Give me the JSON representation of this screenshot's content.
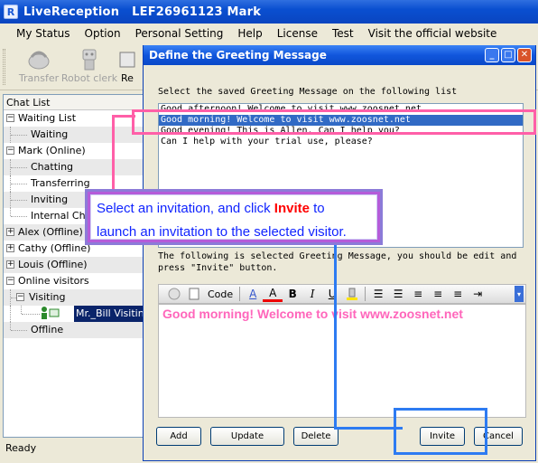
{
  "window": {
    "app_name": "LiveReception",
    "user": "LEF26961123 Mark"
  },
  "menu": [
    "My Status",
    "Option",
    "Personal Setting",
    "Help",
    "License",
    "Test",
    "Visit the official website"
  ],
  "toolbar": {
    "buttons": [
      {
        "label": "Transfer",
        "icon": "transfer-icon"
      },
      {
        "label": "Robot clerk",
        "icon": "robot-icon"
      },
      {
        "label": "Re",
        "icon": "refresh-icon"
      }
    ]
  },
  "chat_list": {
    "header": "Chat List",
    "items": [
      {
        "label": "Waiting List",
        "level": 0,
        "expander": "−"
      },
      {
        "label": "Waiting",
        "level": 1
      },
      {
        "label": "Mark (Online)",
        "level": 0,
        "expander": "−"
      },
      {
        "label": "Chatting",
        "level": 1
      },
      {
        "label": "Transferring",
        "level": 1
      },
      {
        "label": "Inviting",
        "level": 1
      },
      {
        "label": "Internal Chat",
        "level": 1
      },
      {
        "label": "Alex (Offline)",
        "level": 0,
        "expander": "+"
      },
      {
        "label": "Cathy (Offline)",
        "level": 0,
        "expander": "+"
      },
      {
        "label": "Louis (Offline)",
        "level": 0,
        "expander": "+"
      },
      {
        "label": "Online visitors",
        "level": 0,
        "expander": "−"
      },
      {
        "label": "Visiting",
        "level": 1,
        "expander": "−"
      },
      {
        "label": "Mr._Bill Visiting",
        "level": 2,
        "selected": true
      },
      {
        "label": "Offline",
        "level": 1
      }
    ]
  },
  "status_bar": "Ready",
  "dialog": {
    "title": "Define the Greeting Message",
    "list_label": "Select the saved Greeting Message on the following list",
    "greetings": [
      "Good afternoon! Welcome to visit www.zoosnet.net",
      "Good morning! Welcome to visit www.zoosnet.net",
      "Good evening! This is Allen. Can I help you?",
      "Can I help with your trial use, please?"
    ],
    "selected_index": 1,
    "edit_label_1": "The following is selected Greeting Message, you should be edit and",
    "edit_label_2": "press \"Invite\" button.",
    "editor": {
      "code_label": "Code",
      "message": "Good morning! Welcome to visit www.zoosnet.net"
    },
    "buttons": {
      "add": "Add",
      "update": "Update",
      "delete": "Delete",
      "invite": "Invite",
      "cancel": "Cancel"
    }
  },
  "callout": {
    "line1_pre": "Select an invitation, and click ",
    "line1_highlight": "Invite",
    "line1_post": " to",
    "line2": "launch an invitation to the selected visitor."
  },
  "colors": {
    "annotation_pink": "#ff5fa8",
    "annotation_blue": "#2d7bf2",
    "title_blue": "#0a4fd0",
    "message_pink": "#ff66bb",
    "callout_text": "#1024ff"
  }
}
